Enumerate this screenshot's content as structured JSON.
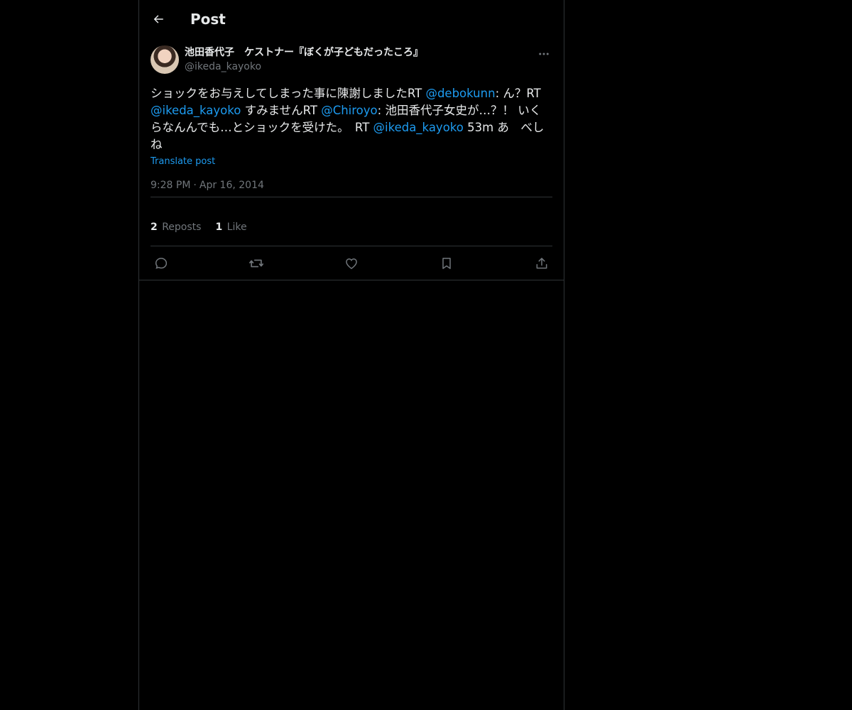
{
  "header": {
    "title": "Post"
  },
  "author": {
    "display_name": "池田香代子　ケストナー『ぼくが子どもだったころ』",
    "handle": "@ikeda_kayoko"
  },
  "post": {
    "segments": [
      {
        "text": "ショックをお与えしてしまった事に陳謝しましたRT ",
        "mention": false
      },
      {
        "text": "@debokunn",
        "mention": true
      },
      {
        "text": ": ん？RT ",
        "mention": false
      },
      {
        "text": "@ikeda_kayoko",
        "mention": true
      },
      {
        "text": " すみませんRT ",
        "mention": false
      },
      {
        "text": "@Chiroyo",
        "mention": true
      },
      {
        "text": ": 池田香代子女史が…？！ いくらなんんでも…とショックを受けた。　RT ",
        "mention": false
      },
      {
        "text": "@ikeda_kayoko",
        "mention": true
      },
      {
        "text": " 53m あ　べし　ね",
        "mention": false
      }
    ],
    "translate_label": "Translate post",
    "time": "9:28 PM",
    "date": "Apr 16, 2014"
  },
  "stats": {
    "reposts_count": "2",
    "reposts_label": "Reposts",
    "likes_count": "1",
    "likes_label": "Like"
  },
  "colors": {
    "accent": "#1d9bf0",
    "muted": "#71767b",
    "border": "#2f3336",
    "background": "#000000"
  },
  "icons": [
    "back-arrow-icon",
    "more-icon",
    "reply-icon",
    "repost-icon",
    "like-icon",
    "bookmark-icon",
    "share-icon"
  ]
}
